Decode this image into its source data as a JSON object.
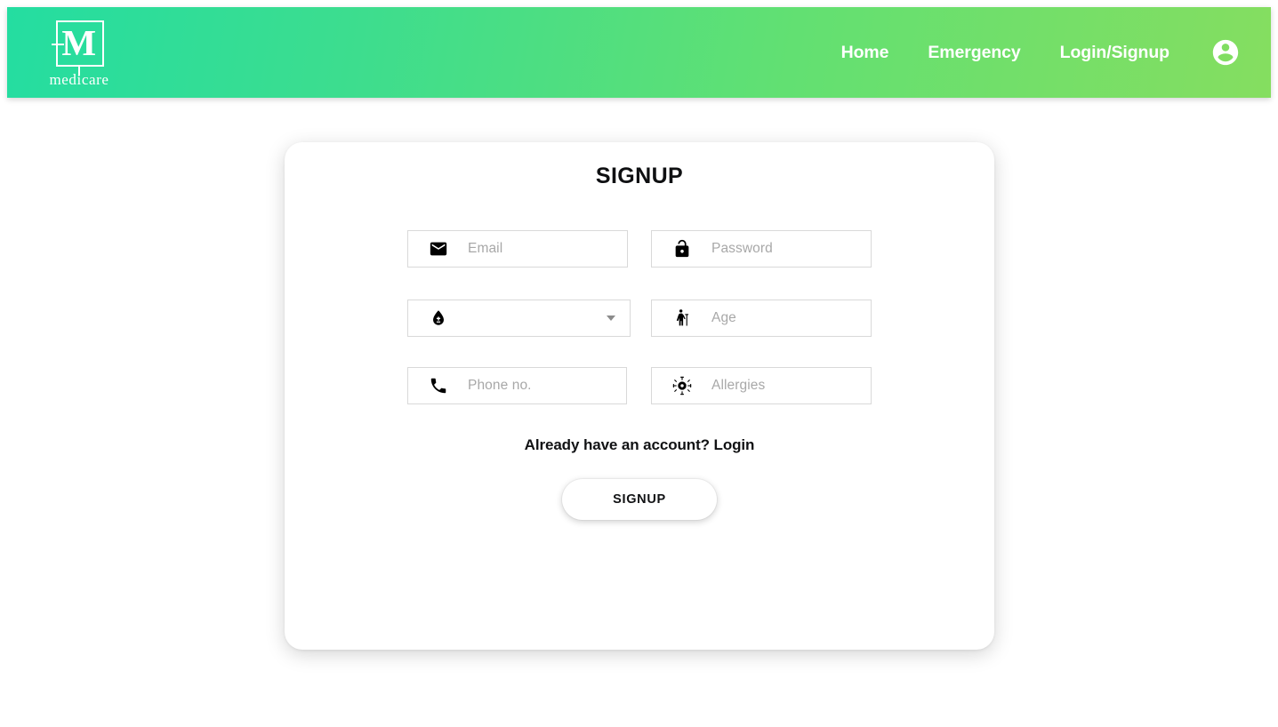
{
  "header": {
    "brand": {
      "letter": "M",
      "word": "medicare",
      "icon": "medicare-logo-icon"
    },
    "nav": [
      {
        "label": "Home",
        "name": "nav-link-home"
      },
      {
        "label": "Emergency",
        "name": "nav-link-emergency"
      },
      {
        "label": "Login/Signup",
        "name": "nav-link-login-signup"
      }
    ],
    "avatar_icon": "account-circle-icon",
    "gradient_from": "#24dda1",
    "gradient_to": "#85de60"
  },
  "card": {
    "title": "SIGNUP",
    "fields": {
      "email": {
        "placeholder": "Email",
        "icon": "email-icon",
        "value": ""
      },
      "password": {
        "placeholder": "Password",
        "icon": "lock-open-icon",
        "value": ""
      },
      "bloodtype": {
        "placeholder": "",
        "icon": "bloodtype-icon",
        "value": "",
        "selected": ""
      },
      "age": {
        "placeholder": "Age",
        "icon": "elderly-icon",
        "value": ""
      },
      "phone": {
        "placeholder": "Phone no.",
        "icon": "phone-icon",
        "value": ""
      },
      "allergies": {
        "placeholder": "Allergies",
        "icon": "coronavirus-icon",
        "value": ""
      }
    },
    "login_prompt": "Already have an account? Login",
    "submit_label": "SIGNUP"
  },
  "colors": {
    "placeholder": "#a8a8a8",
    "border": "#d9d9d9",
    "text": "#111214",
    "page_bg": "#ffffff"
  }
}
